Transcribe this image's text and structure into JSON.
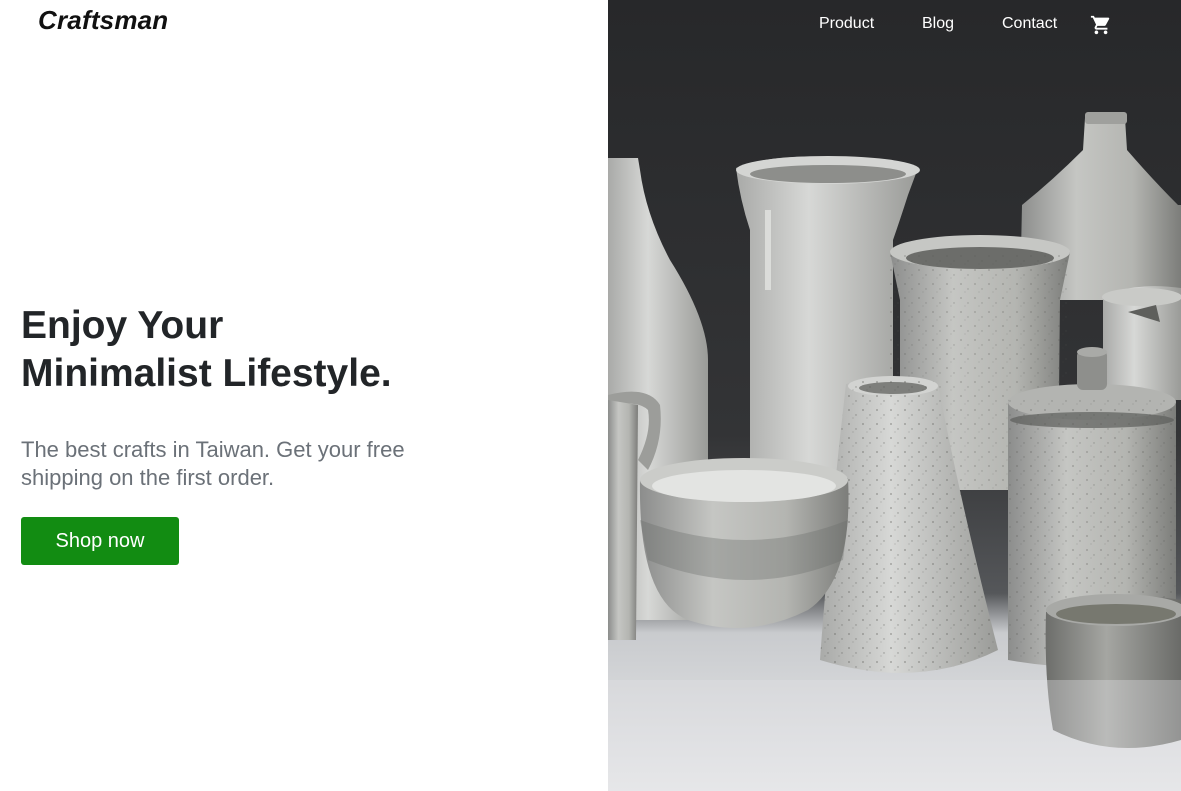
{
  "brand": {
    "name": "Craftsman"
  },
  "nav": {
    "items": [
      {
        "label": "Product"
      },
      {
        "label": "Blog"
      },
      {
        "label": "Contact"
      }
    ],
    "cart_icon": "shopping-cart-icon"
  },
  "hero": {
    "title_line1": "Enjoy Your",
    "title_line2": "Minimalist Lifestyle.",
    "subtitle": "The best crafts in Taiwan. Get your free shipping on the first order.",
    "cta_label": "Shop now"
  },
  "colors": {
    "cta_background": "#128c12",
    "heading": "#222528",
    "subtitle": "#6b7178"
  }
}
